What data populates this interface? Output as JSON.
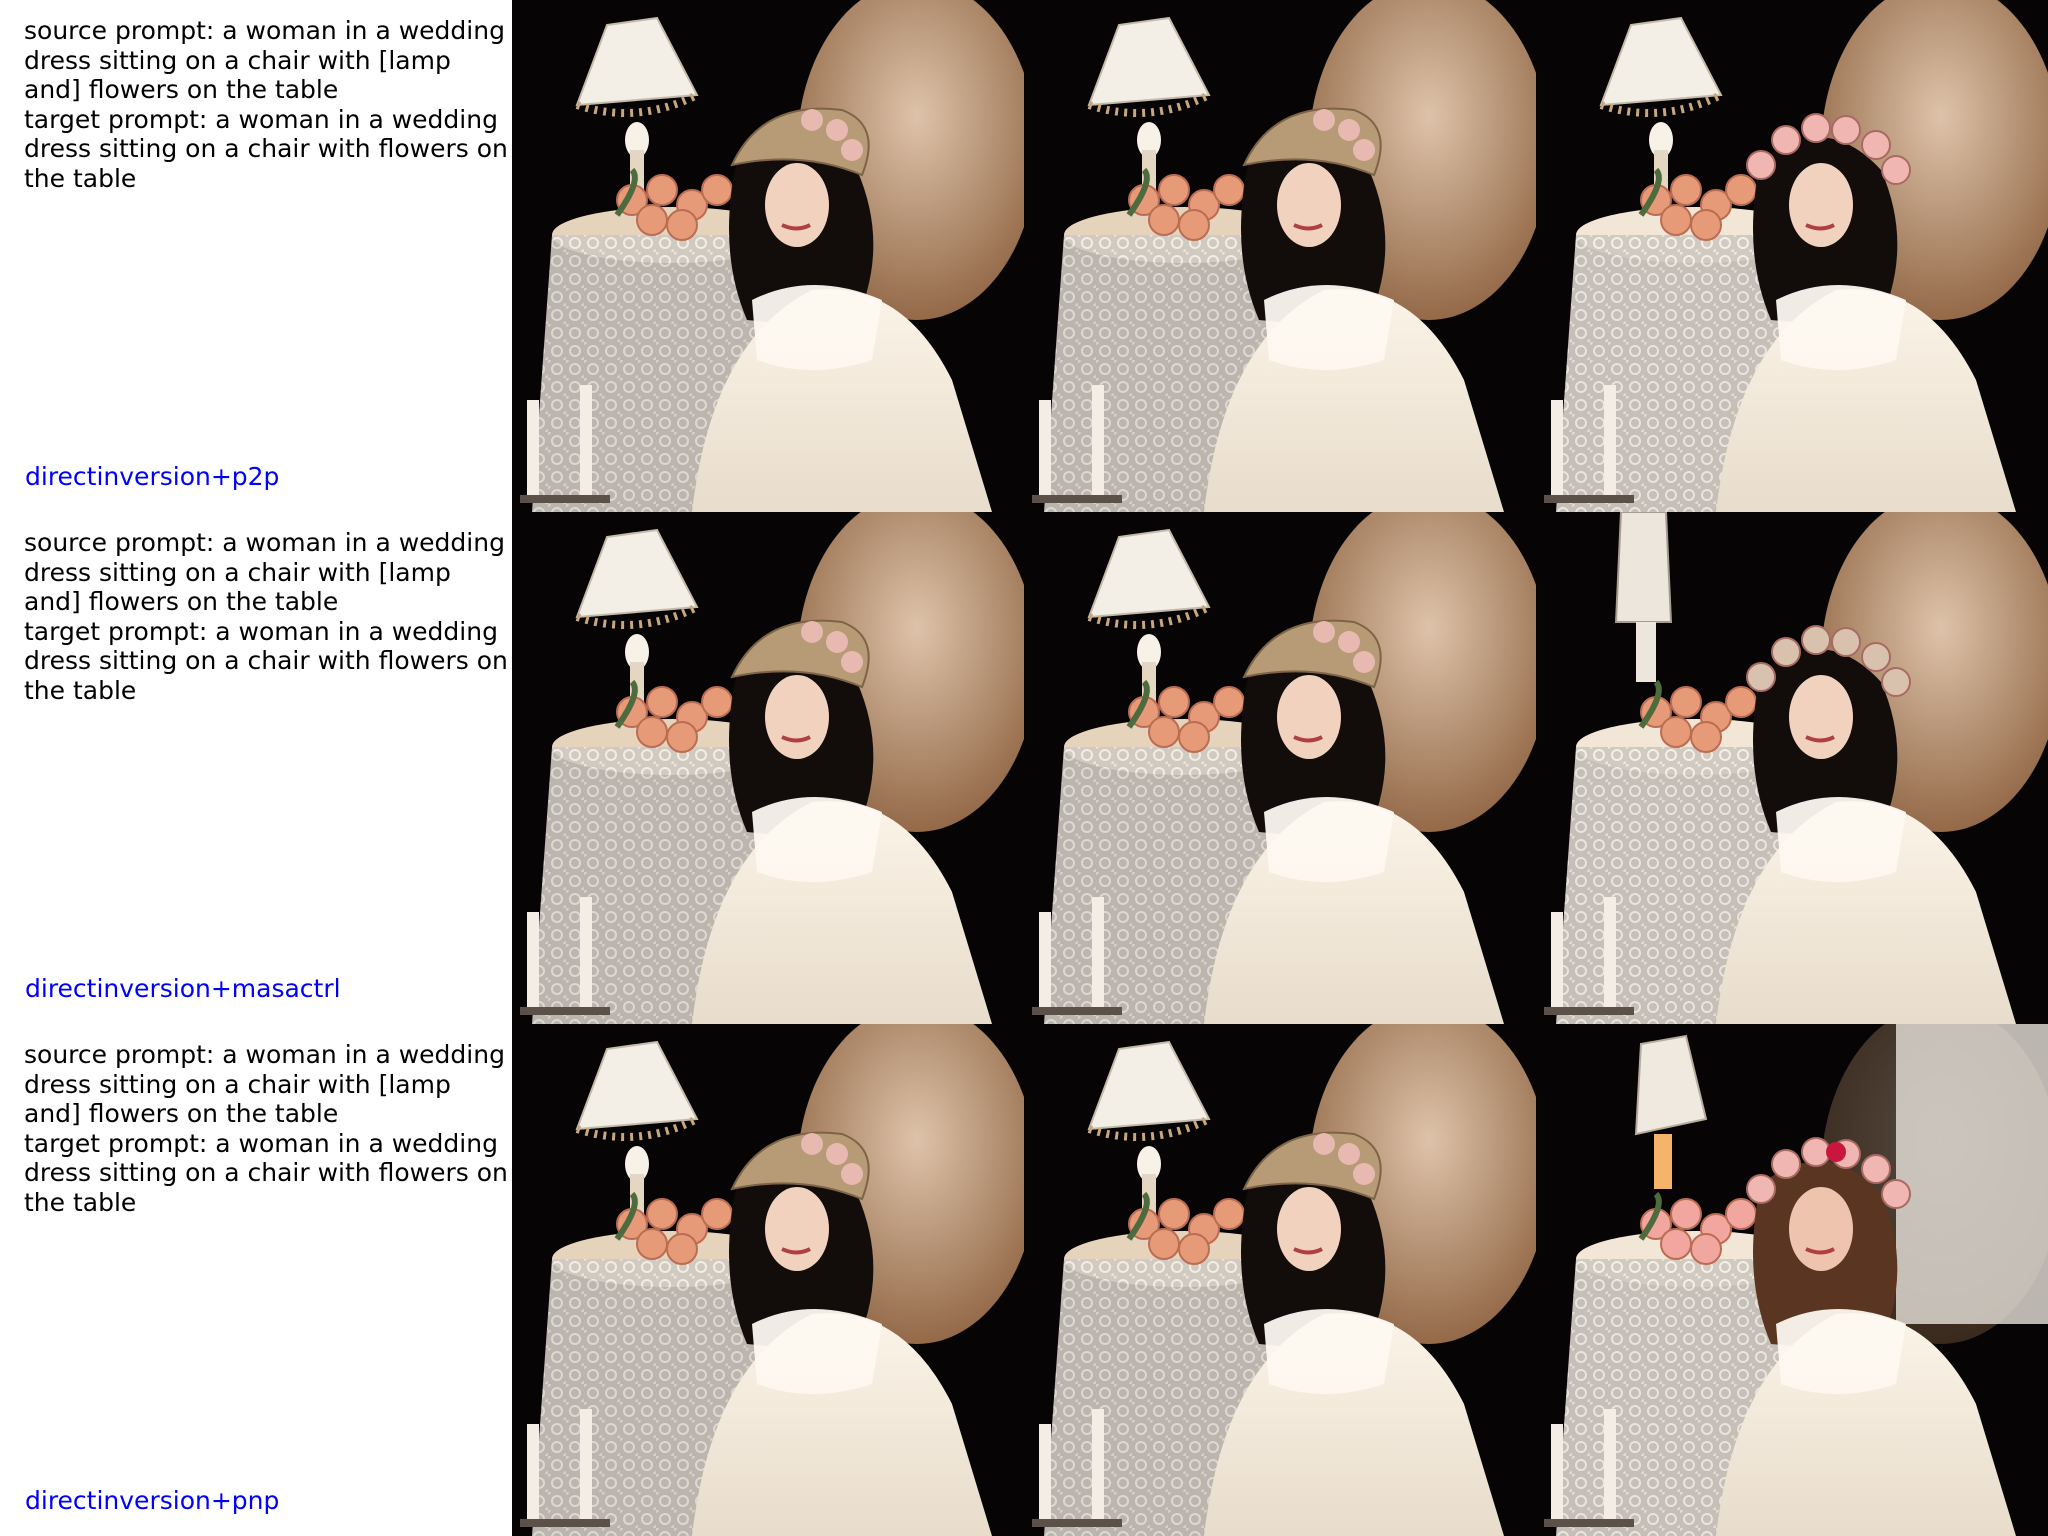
{
  "rows": [
    {
      "source_prompt": "source prompt: a woman in a wedding dress sitting on a chair with [lamp and] flowers on the table",
      "target_prompt": "target prompt: a woman in a wedding dress sitting on a chair with flowers on the table",
      "method": "directinversion+p2p"
    },
    {
      "source_prompt": "source prompt: a woman in a wedding dress sitting on a chair with [lamp and] flowers on the table",
      "target_prompt": "target prompt: a woman in a wedding dress sitting on a chair with flowers on the table",
      "method": "directinversion+masactrl"
    },
    {
      "source_prompt": "source prompt: a woman in a wedding dress sitting on a chair with [lamp and] flowers on the table",
      "target_prompt": "target prompt: a woman in a wedding dress sitting on a chair with flowers on the table",
      "method": "directinversion+pnp"
    }
  ],
  "colors": {
    "method_label": "#0000ff",
    "prompt_text": "#000000",
    "photo_background": "#060404"
  }
}
